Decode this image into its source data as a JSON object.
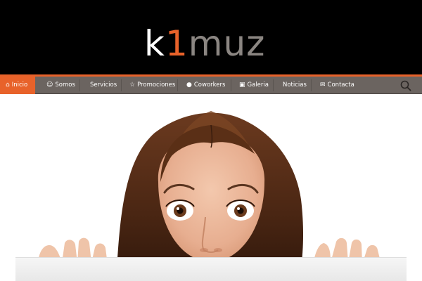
{
  "logo": {
    "part1": "k",
    "part2": "1",
    "part3": "muz"
  },
  "nav": {
    "items": [
      {
        "label": "Inicio",
        "icon": "home-icon",
        "active": true
      },
      {
        "label": "Somos",
        "icon": "smile-icon"
      },
      {
        "label": "Servicios",
        "icon": ""
      },
      {
        "label": "Promociones",
        "icon": "star-icon"
      },
      {
        "label": "Coworkers",
        "icon": "users-icon"
      },
      {
        "label": "Galeria",
        "icon": "camera-icon"
      },
      {
        "label": "Noticias",
        "icon": ""
      },
      {
        "label": "Contacta",
        "icon": "mail-icon"
      }
    ],
    "search_icon": "search-icon"
  },
  "colors": {
    "accent": "#e8622a",
    "nav_bg": "#6b6460",
    "header_bg": "#000000"
  }
}
